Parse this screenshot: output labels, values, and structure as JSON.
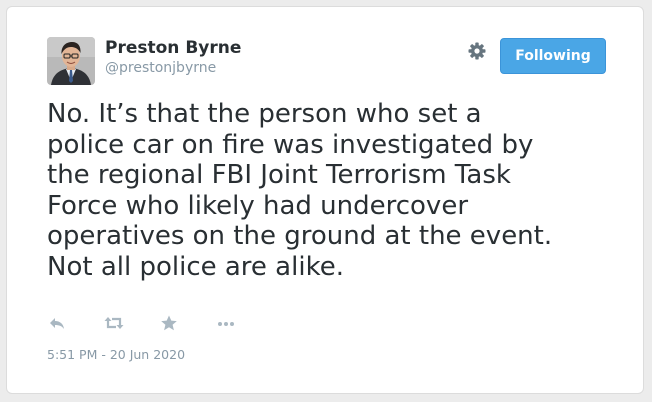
{
  "author": {
    "name": "Preston Byrne",
    "handle": "@prestonjbyrne",
    "avatar_icon": "user-photo"
  },
  "follow_button": {
    "label": "Following",
    "color": "#4aa6e6"
  },
  "settings_icon": "gear-icon",
  "tweet": {
    "text": "No. It’s that the person who set a\npolice car on fire was investigated by\nthe regional FBI Joint Terrorism Task\nForce who likely had undercover\noperatives on the ground at the event.\nNot all police are alike."
  },
  "actions": [
    {
      "name": "reply",
      "icon": "reply-icon"
    },
    {
      "name": "retweet",
      "icon": "retweet-icon"
    },
    {
      "name": "like",
      "icon": "star-icon"
    },
    {
      "name": "more",
      "icon": "more-icon"
    }
  ],
  "timestamp": "5:51 PM - 20 Jun 2020",
  "colors": {
    "text": "#292f33",
    "muted": "#8899a6",
    "icon": "#aab8c2",
    "background": "#ececec"
  }
}
